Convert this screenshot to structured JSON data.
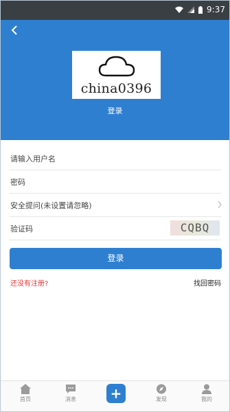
{
  "status_bar": {
    "time": "9:37"
  },
  "header": {
    "back_icon": "chevron-left",
    "logo_text": "china0396",
    "title": "登录"
  },
  "form": {
    "username_placeholder": "请输入用户名",
    "password_placeholder": "密码",
    "security_question": "安全提问(未设置请忽略)",
    "captcha_placeholder": "验证码",
    "captcha_code": "CQBQ"
  },
  "actions": {
    "login": "登录",
    "register": "还没有注册?",
    "forgot_password": "找回密码"
  },
  "tabbar": {
    "home": "首页",
    "messages": "消息",
    "discover": "发现",
    "mine": "我的"
  },
  "colors": {
    "primary": "#2f7fd1",
    "link_red": "#e53935"
  }
}
